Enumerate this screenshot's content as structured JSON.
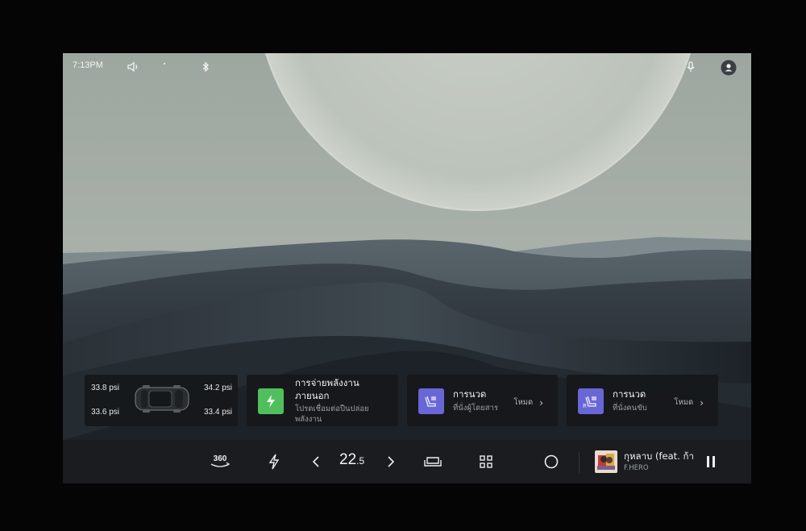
{
  "status_bar": {
    "time": "7:13PM",
    "icons": [
      "speaker-icon",
      "mobile-signal-icon",
      "bluetooth-icon",
      "microphone-icon",
      "user-profile-icon"
    ]
  },
  "tire_pressure": {
    "front_left": "33.8 psi",
    "front_right": "34.2 psi",
    "rear_left": "33.6 psi",
    "rear_right": "33.4 psi"
  },
  "power_card": {
    "title_line1": "การจ่ายพลังงาน",
    "title_line2": "ภายนอก",
    "subtitle_line1": "โปรดเชื่อมต่อปืนปล่อย",
    "subtitle_line2": "พลังงาน",
    "icon": "lightning-bolt-icon",
    "accent": "#4fbf5e"
  },
  "massage_passenger": {
    "title": "การนวด",
    "subtitle": "ที่นั่งผู้โดยสาร",
    "mode_label": "โหมด",
    "icon": "seat-massage-icon",
    "accent": "#6966d6"
  },
  "massage_driver": {
    "title": "การนวด",
    "subtitle": "ที่นั่งคนขับ",
    "mode_label": "โหมด",
    "icon": "seat-massage-icon",
    "seat_mark": "R",
    "accent": "#6966d6"
  },
  "dock": {
    "camera_label": "360",
    "temperature_main": "22",
    "temperature_decimal": ".5",
    "song_title": "กุหลาบ (feat. ก้า",
    "artist": "F.HERO"
  }
}
